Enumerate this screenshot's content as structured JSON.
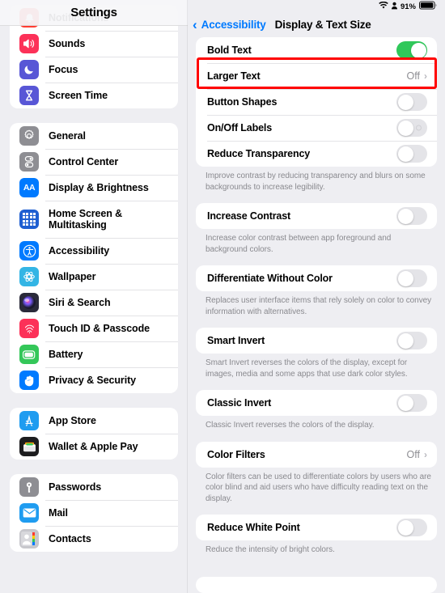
{
  "status_bar": {
    "wifi_icon": "wifi-icon",
    "person_icon": "person-icon",
    "battery_percent": "91%",
    "battery_icon": "battery-icon"
  },
  "sidebar": {
    "title": "Settings",
    "groups": [
      {
        "items": [
          {
            "label": "Notifications",
            "icon": "notifications-icon",
            "color": "#ff3b30",
            "partial": true
          },
          {
            "label": "Sounds",
            "icon": "sounds-icon",
            "color": "#fc3158"
          },
          {
            "label": "Focus",
            "icon": "focus-icon",
            "color": "#5856d6"
          },
          {
            "label": "Screen Time",
            "icon": "screen-time-icon",
            "color": "#5856d6"
          }
        ]
      },
      {
        "items": [
          {
            "label": "General",
            "icon": "gear-icon",
            "color": "#8e8e93"
          },
          {
            "label": "Control Center",
            "icon": "control-center-icon",
            "color": "#8e8e93"
          },
          {
            "label": "Display & Brightness",
            "icon": "display-brightness-icon",
            "color": "#007aff"
          },
          {
            "label": "Home Screen & Multitasking",
            "icon": "home-screen-icon",
            "color": "#1f5fd1"
          },
          {
            "label": "Accessibility",
            "icon": "accessibility-icon",
            "color": "#007aff"
          },
          {
            "label": "Wallpaper",
            "icon": "wallpaper-icon",
            "color": "#33b5e5"
          },
          {
            "label": "Siri & Search",
            "icon": "siri-icon",
            "color": "#2a2a3a"
          },
          {
            "label": "Touch ID & Passcode",
            "icon": "touch-id-icon",
            "color": "#fc3158"
          },
          {
            "label": "Battery",
            "icon": "battery-icon",
            "color": "#34c759"
          },
          {
            "label": "Privacy & Security",
            "icon": "privacy-security-icon",
            "color": "#007aff"
          }
        ]
      },
      {
        "items": [
          {
            "label": "App Store",
            "icon": "app-store-icon",
            "color": "#1f9cf0"
          },
          {
            "label": "Wallet & Apple Pay",
            "icon": "wallet-icon",
            "color": "#1c1c1e"
          }
        ]
      },
      {
        "items": [
          {
            "label": "Passwords",
            "icon": "passwords-icon",
            "color": "#8e8e93"
          },
          {
            "label": "Mail",
            "icon": "mail-icon",
            "color": "#1f9cf0"
          },
          {
            "label": "Contacts",
            "icon": "contacts-icon",
            "color": "#c7c7cc"
          }
        ]
      }
    ]
  },
  "navbar": {
    "back_label": "Accessibility",
    "back_icon": "chevron-left-icon",
    "title": "Display & Text Size"
  },
  "main": {
    "sections": [
      {
        "rows": [
          {
            "label": "Bold Text",
            "control": "toggle",
            "on": true,
            "highlighted": true
          },
          {
            "label": "Larger Text",
            "control": "disclosure",
            "value": "Off"
          },
          {
            "label": "Button Shapes",
            "control": "toggle",
            "on": false
          },
          {
            "label": "On/Off Labels",
            "control": "toggle",
            "on": false,
            "off_mark": true
          },
          {
            "label": "Reduce Transparency",
            "control": "toggle",
            "on": false
          }
        ],
        "footnote": "Improve contrast by reducing transparency and blurs on some backgrounds to increase legibility."
      },
      {
        "rows": [
          {
            "label": "Increase Contrast",
            "control": "toggle",
            "on": false
          }
        ],
        "footnote": "Increase color contrast between app foreground and background colors."
      },
      {
        "rows": [
          {
            "label": "Differentiate Without Color",
            "control": "toggle",
            "on": false
          }
        ],
        "footnote": "Replaces user interface items that rely solely on color to convey information with alternatives."
      },
      {
        "rows": [
          {
            "label": "Smart Invert",
            "control": "toggle",
            "on": false
          }
        ],
        "footnote": "Smart Invert reverses the colors of the display, except for images, media and some apps that use dark color styles."
      },
      {
        "rows": [
          {
            "label": "Classic Invert",
            "control": "toggle",
            "on": false
          }
        ],
        "footnote": "Classic Invert reverses the colors of the display."
      },
      {
        "rows": [
          {
            "label": "Color Filters",
            "control": "disclosure",
            "value": "Off"
          }
        ],
        "footnote": "Color filters can be used to differentiate colors by users who are color blind and aid users who have difficulty reading text on the display."
      },
      {
        "rows": [
          {
            "label": "Reduce White Point",
            "control": "toggle",
            "on": false
          }
        ],
        "footnote": "Reduce the intensity of bright colors."
      },
      {
        "rows": [],
        "footnote": ""
      }
    ],
    "chevron_glyph": "›",
    "highlight_color": "#ff0000",
    "toggle_on_color": "#30c85a"
  }
}
